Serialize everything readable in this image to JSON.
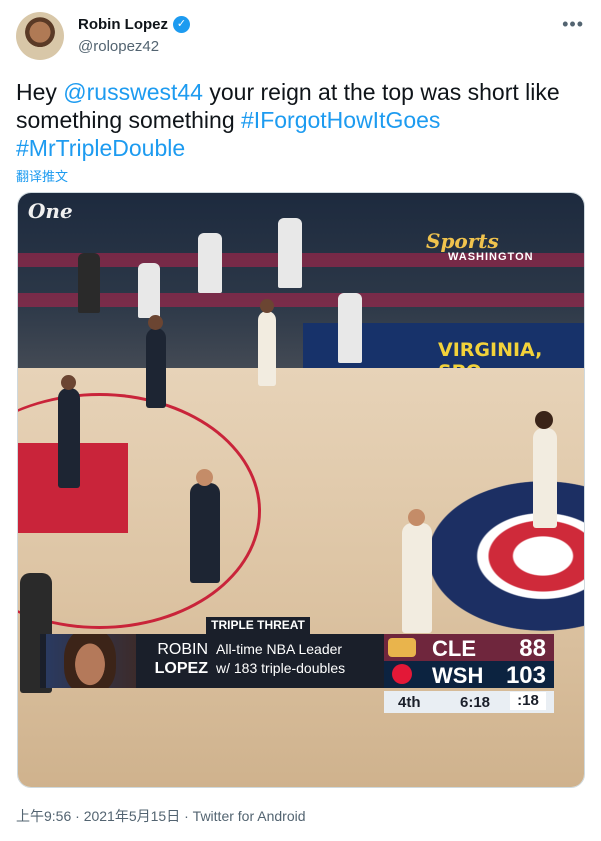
{
  "author": {
    "name": "Robin Lopez",
    "handle": "@rolopez42",
    "verified_icon": "verified-badge-icon"
  },
  "more_icon": "more-horizontal-icon",
  "tweet": {
    "text_prefix": "Hey ",
    "mention": "@russwest44",
    "text_middle": " your reign at the top was short like something something ",
    "hashtag1": "#IForgotHowItGoes",
    "hashtag2": "#MrTripleDouble"
  },
  "translate_label": "翻译推文",
  "media": {
    "arena_sign_left": "One",
    "broadcaster": "Sports",
    "broadcaster_sub": "WASHINGTON",
    "ad_board": "VIRGINIA, SPO",
    "overlay": {
      "badge": "TRIPLE THREAT",
      "first_name": "ROBIN",
      "last_name": "LOPEZ",
      "stat_line1": "All-time NBA Leader",
      "stat_line2": "w/ 183 triple-doubles",
      "teams": [
        {
          "abbr": "CLE",
          "score": "88",
          "color": "#6f263d"
        },
        {
          "abbr": "WSH",
          "score": "103",
          "color": "#0c2340"
        }
      ],
      "period": "4th",
      "clock": "6:18",
      "shot_clock": ":18"
    }
  },
  "footer": {
    "time": "上午9:56",
    "separator": "·",
    "date": "2021年5月15日",
    "client": "Twitter for Android"
  },
  "colors": {
    "link": "#1d9bf0",
    "text": "#0f1419",
    "secondary": "#536471"
  }
}
